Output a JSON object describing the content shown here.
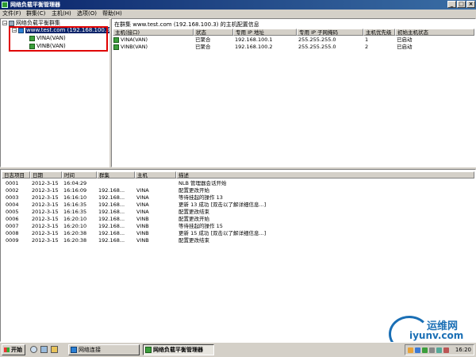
{
  "window": {
    "title": "网络负载平衡管理器",
    "minimize_glyph": "_",
    "maximize_glyph": "□",
    "close_glyph": "×"
  },
  "menu": [
    "文件(F)",
    "群集(C)",
    "主机(H)",
    "选项(O)",
    "帮助(H)"
  ],
  "tree": {
    "root_label": "网络负载平衡群集",
    "cluster_label": "www.test.com (192.168.100.3)",
    "hosts": [
      "VINA(VAN)",
      "VINB(VAN)"
    ]
  },
  "hosts_pane": {
    "title": "在群集 www.test.com (192.168.100.3) 的主机配置信息",
    "columns": [
      "主机(接口)",
      "状态",
      "专用 IP 地址",
      "专用 IP 子网掩码",
      "主机优先级",
      "初始主机状态"
    ],
    "rows": [
      [
        "VINA(VAN)",
        "已聚合",
        "192.168.100.1",
        "255.255.255.0",
        "1",
        "已启动"
      ],
      [
        "VINB(VAN)",
        "已聚合",
        "192.168.100.2",
        "255.255.255.0",
        "2",
        "已启动"
      ]
    ]
  },
  "log_pane": {
    "columns": [
      "日志项目",
      "日期",
      "时间",
      "群集",
      "主机",
      "描述"
    ],
    "rows": [
      [
        "0001",
        "2012-3-15",
        "16:04:29",
        "",
        "",
        "NLB 管理器会话开始"
      ],
      [
        "0002",
        "2012-3-15",
        "16:16:09",
        "192.168...",
        "VINA",
        "配置更改开始"
      ],
      [
        "0003",
        "2012-3-15",
        "16:16:10",
        "192.168...",
        "VINA",
        "等待挂起的操作 13"
      ],
      [
        "0004",
        "2012-3-15",
        "16:16:35",
        "192.168...",
        "VINA",
        "更新 13 成功 [双击以了解详细信息...]"
      ],
      [
        "0005",
        "2012-3-15",
        "16:16:35",
        "192.168...",
        "VINA",
        "配置更改结束"
      ],
      [
        "0006",
        "2012-3-15",
        "16:20:10",
        "192.168...",
        "VINB",
        "配置更改开始"
      ],
      [
        "0007",
        "2012-3-15",
        "16:20:10",
        "192.168...",
        "VINB",
        "等待挂起的操作 15"
      ],
      [
        "0008",
        "2012-3-15",
        "16:20:38",
        "192.168...",
        "VINB",
        "更新 15 成功 [双击以了解详细信息...]"
      ],
      [
        "0009",
        "2012-3-15",
        "16:20:38",
        "192.168...",
        "VINB",
        "配置更改结束"
      ]
    ]
  },
  "watermark": {
    "cn": "运维网",
    "url": "iyunv.com"
  },
  "taskbar": {
    "start_label": "开始",
    "tasks": [
      {
        "label": "网络连接",
        "active": false
      },
      {
        "label": "网络负载平衡管理器",
        "active": true
      }
    ],
    "clock": "16:20"
  },
  "colors": {
    "titlebar": "#0a246a",
    "selection": "#0a246a",
    "highlight_box": "#e00000",
    "watermark": "#1a6fb5"
  }
}
